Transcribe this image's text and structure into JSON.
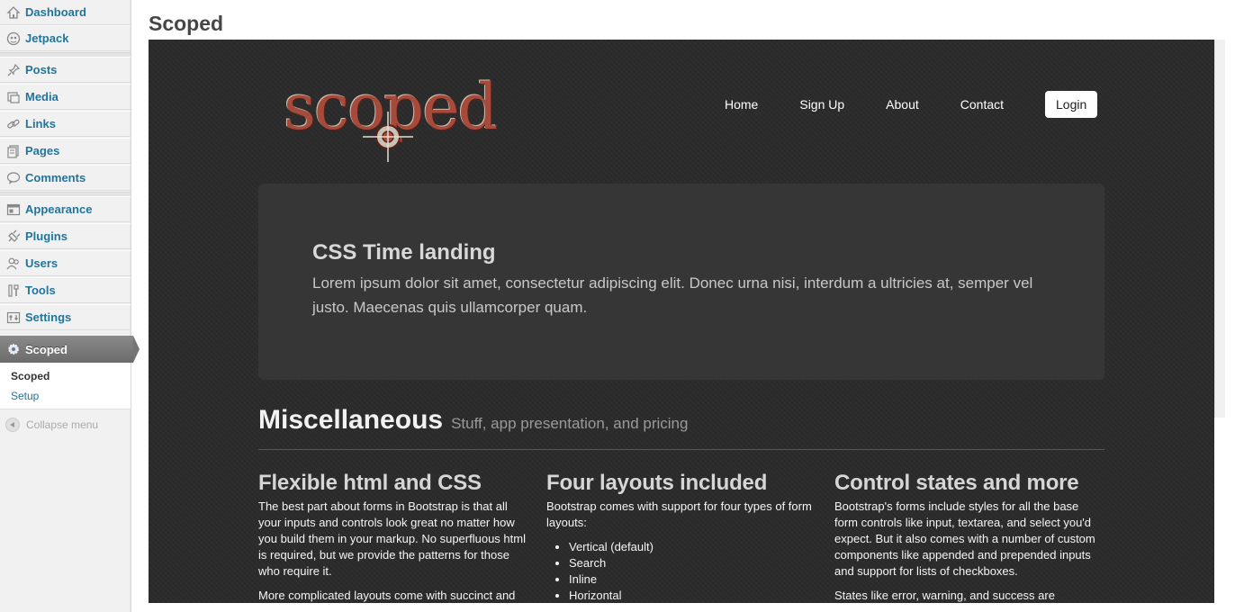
{
  "admin_menu": {
    "items": [
      {
        "label": "Dashboard",
        "icon": "dashboard-icon"
      },
      {
        "label": "Jetpack",
        "icon": "jetpack-icon"
      },
      {
        "label": "Posts",
        "icon": "pin-icon"
      },
      {
        "label": "Media",
        "icon": "media-icon"
      },
      {
        "label": "Links",
        "icon": "link-icon"
      },
      {
        "label": "Pages",
        "icon": "pages-icon"
      },
      {
        "label": "Comments",
        "icon": "comment-icon"
      },
      {
        "label": "Appearance",
        "icon": "appearance-icon"
      },
      {
        "label": "Plugins",
        "icon": "plugin-icon"
      },
      {
        "label": "Users",
        "icon": "users-icon"
      },
      {
        "label": "Tools",
        "icon": "tools-icon"
      },
      {
        "label": "Settings",
        "icon": "settings-icon"
      }
    ],
    "current": {
      "label": "Scoped",
      "icon": "gear-icon"
    },
    "submenu": [
      "Scoped",
      "Setup"
    ],
    "collapse_label": "Collapse menu"
  },
  "page": {
    "title": "Scoped"
  },
  "site": {
    "logo_text": "scoped",
    "nav": [
      "Home",
      "Sign Up",
      "About",
      "Contact"
    ],
    "login_label": "Login",
    "hero": {
      "title": "CSS Time landing",
      "text": "Lorem ipsum dolor sit amet, consectetur adipiscing elit. Donec urna nisi, interdum a ultricies at, semper vel justo. Maecenas quis ullamcorper quam."
    },
    "misc": {
      "title": "Miscellaneous",
      "subtitle": "Stuff, app presentation, and pricing"
    },
    "columns": [
      {
        "title": "Flexible html and CSS",
        "text": "The best part about forms in Bootstrap is that all your inputs and controls look great no matter how you build them in your markup. No superfluous html is required, but we provide the patterns for those who require it.",
        "text2": "More complicated layouts come with succinct and"
      },
      {
        "title": "Four layouts included",
        "text": "Bootstrap comes with support for four types of form layouts:",
        "list": [
          "Vertical (default)",
          "Search",
          "Inline",
          "Horizontal"
        ]
      },
      {
        "title": "Control states and more",
        "text": "Bootstrap's forms include styles for all the base form controls like input, textarea, and select you'd expect. But it also comes with a number of custom components like appended and prepended inputs and support for lists of checkboxes.",
        "text2": "States like error, warning, and success are"
      }
    ]
  },
  "colors": {
    "wp_link": "#21759b",
    "logo_red": "#a64a3b",
    "preview_bg": "#2b2b2b",
    "hero_bg": "#363636"
  }
}
